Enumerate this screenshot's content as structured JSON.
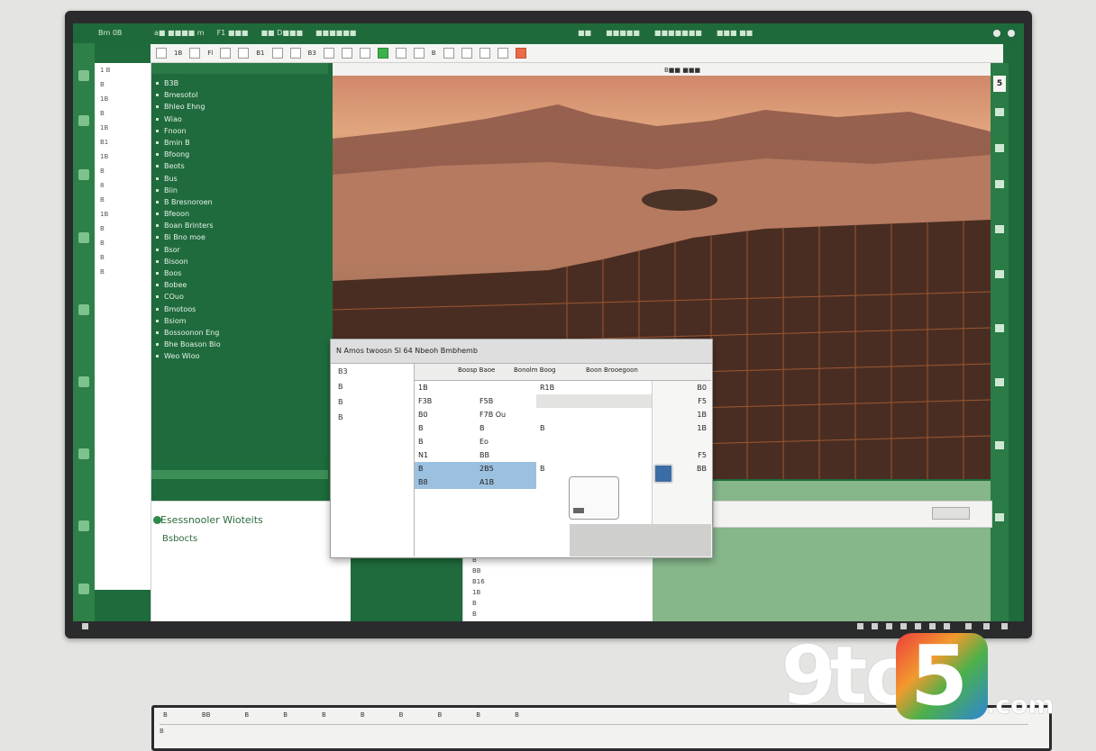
{
  "window": {
    "app_name": "Bm 0B",
    "menus": [
      "a■ ■■■■ m",
      "F1 ■■■",
      "■■ D■■■",
      "■■■■■■"
    ],
    "center_labels": [
      "■■",
      "■■■■■",
      "■■■■■■■",
      "■■■ ■■"
    ]
  },
  "toolbar": {
    "chips": [
      "1B",
      "Fl",
      "B1",
      "B3",
      "B"
    ],
    "photo_tag": "B■■ ■■■"
  },
  "left_column": {
    "rows": [
      "1 B",
      "B",
      "1B",
      "B",
      "1B",
      "B1",
      "1B",
      "B",
      "8",
      "B",
      "1B",
      "B",
      "B",
      "B",
      "B"
    ]
  },
  "nav_panel": {
    "items": [
      "B3B",
      "Bmesotol",
      "Bhleo Ehng",
      "Wiao",
      "Fnoon",
      "Bmin B",
      "Bfoong",
      "Beots",
      "Bus",
      "Biin",
      "B Bresnoroen",
      "Bfeoon",
      "Boan Brinters",
      "Bi Bno moe",
      "Bsor",
      "Bisoon",
      "Boos",
      "Bobee",
      "COuo",
      "Bmotoos",
      "Bsiom",
      "Bossoonon Eng",
      "Bhe Boason Bio",
      "Weo Wioo"
    ]
  },
  "bottom_panel": {
    "title": "Esessnooler Wioteits",
    "subtitle": "Bsbocts"
  },
  "mid_white_values": [
    "B",
    "BB",
    "B16",
    "1B",
    "B",
    "B"
  ],
  "dialog": {
    "title": "N Amos twoosn Sl 64 Nbeoh Bmbhemb",
    "headers": [
      "Boosp Baoe",
      "Bonolm Boog",
      "Boon Brooegoon"
    ],
    "left_values": [
      "B3",
      "B",
      "B",
      "B"
    ],
    "grid_rows": [
      {
        "a": "1B",
        "b": ""
      },
      {
        "a": "F3B",
        "b": "F5B"
      },
      {
        "a": "B0",
        "b": "F7B Ou"
      },
      {
        "a": "B",
        "b": "B"
      },
      {
        "a": "B",
        "b": "Eo"
      },
      {
        "a": "N1",
        "b": "BB"
      },
      {
        "a": "B",
        "b": "2B5"
      },
      {
        "a": "B8",
        "b": "A1B"
      }
    ],
    "mid_rows": [
      "R1B",
      "",
      "",
      "B",
      "",
      "",
      "B",
      ""
    ],
    "right_rows": [
      "B0",
      "F5",
      "1B",
      "1B",
      "",
      "F5",
      "BB",
      ""
    ]
  },
  "right_panel": {
    "number": "5"
  },
  "keyboard": {
    "keys": [
      "B",
      "BB",
      "B",
      "B",
      "B",
      "B",
      "B",
      "B",
      "B",
      "B"
    ],
    "sub": "B"
  },
  "logo": {
    "nine": "9",
    "to": "to",
    "five": "5",
    "com": ".com"
  }
}
